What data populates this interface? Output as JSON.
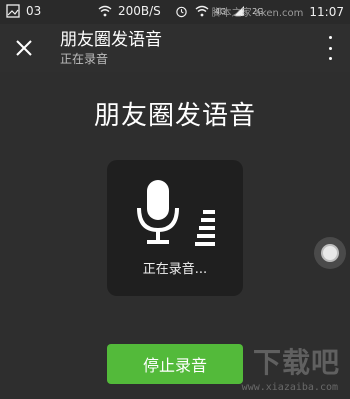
{
  "status_bar": {
    "left_label": "03",
    "network_speed": "200B/S",
    "signal_4g": "4G",
    "signal_2g": "2G",
    "watermark_text": "脚本之家 aken.com",
    "time": "11:07"
  },
  "header": {
    "title": "朋友圈发语音",
    "subtitle": "正在录音"
  },
  "main": {
    "title": "朋友圈发语音",
    "recording_status": "正在录音...",
    "stop_button_label": "停止录音"
  },
  "watermark": {
    "brand": "下载吧",
    "url": "www.xiazaiba.com"
  },
  "colors": {
    "background": "#2e2e2e",
    "panel": "#1f1f1f",
    "accent_green": "#53ba3a"
  }
}
